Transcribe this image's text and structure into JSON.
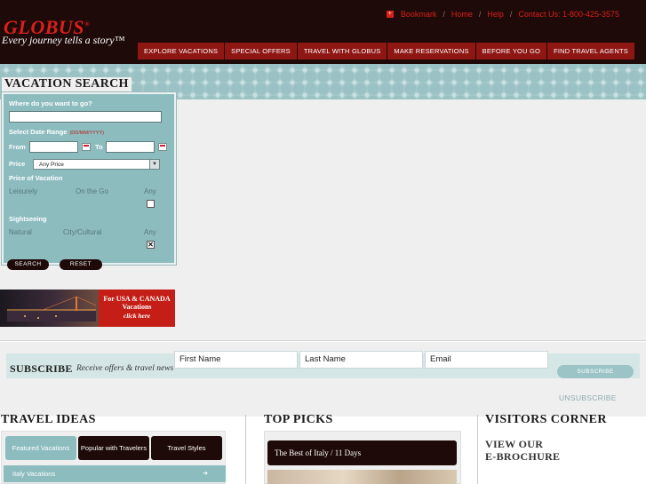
{
  "header": {
    "logo": "GLOBUS",
    "logo_mark": "®",
    "tagline": "Every journey tells a story™",
    "top_links": {
      "bookmark": "Bookmark",
      "home": "Home",
      "help": "Help",
      "contact": "Contact Us: 1-800-425-3575",
      "separator": "/"
    },
    "nav": [
      "EXPLORE VACATIONS",
      "SPECIAL OFFERS",
      "TRAVEL WITH GLOBUS",
      "MAKE RESERVATIONS",
      "BEFORE YOU GO",
      "FIND TRAVEL AGENTS"
    ]
  },
  "search": {
    "title": "VACATION SEARCH",
    "where_label": "Where do you want to go?",
    "where_value": "",
    "date_label": "Select Date Range",
    "date_hint": "(DD/MM/YYYY)",
    "from_label": "From",
    "to_label": "To",
    "price_label": "Price",
    "price_value": "Any Price",
    "price_of_vacation_label": "Price of Vacation",
    "pace": {
      "leisurely": "Leisurely",
      "on_the_go": "On the Go",
      "any": "Any"
    },
    "pace_any_checked": false,
    "sightseeing_label": "Sightseeing",
    "sightseeing": {
      "natural": "Natural",
      "city": "City/Cultural",
      "any": "Any"
    },
    "sightseeing_any_checked": true,
    "check_mark": "✕",
    "search_button": "SEARCH",
    "reset_button": "RESET"
  },
  "promo": {
    "line1": "For USA & CANADA",
    "line2": "Vacations",
    "line3": "click here"
  },
  "subscribe": {
    "title": "SUBSCRIBE",
    "tagline": "Receive offers & travel news",
    "first_name_placeholder": "First Name",
    "last_name_placeholder": "Last Name",
    "email_placeholder": "Email",
    "button": "SUBSCRIBE",
    "unsubscribe": "UNSUBSCRIBE"
  },
  "travel_ideas": {
    "title": "TRAVEL IDEAS",
    "tabs": [
      "Featured Vacations",
      "Popular with Travelers",
      "Travel Styles"
    ],
    "active_tab": 0,
    "first_item": "Italy Vacations",
    "arrow": "➔"
  },
  "top_picks": {
    "title": "TOP PICKS",
    "card": "The Best of Italy / 11 Days"
  },
  "visitors_corner": {
    "title": "VISITORS CORNER",
    "sub_line1": "VIEW OUR",
    "sub_line2": "E-BROCHURE"
  },
  "colors": {
    "brand_dark": "#1e0a08",
    "brand_red": "#8e1713",
    "accent_teal": "#8dbcbf",
    "link_red": "#d9201c"
  }
}
